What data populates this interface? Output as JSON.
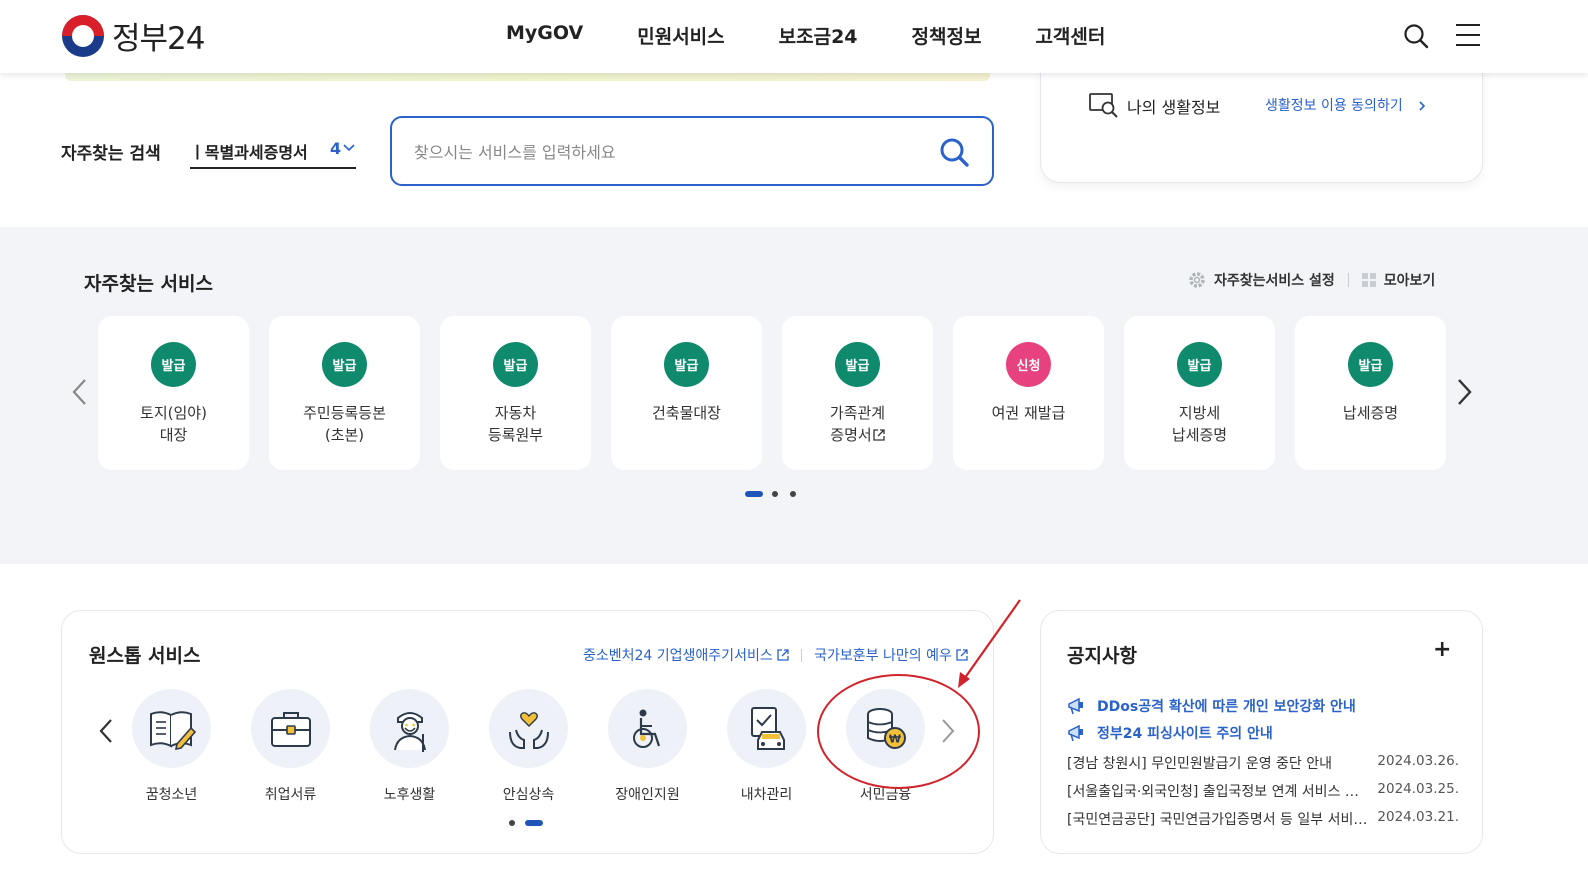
{
  "header": {
    "logo_text": "정부24",
    "nav": [
      "MyGOV",
      "민원서비스",
      "보조금24",
      "정책정보",
      "고객센터"
    ]
  },
  "search": {
    "freq_label": "자주찾는 검색",
    "freq_keyword": "ㅣ목별과세증명서",
    "freq_index": "4",
    "placeholder": "찾으시는 서비스를 입력하세요",
    "value": ""
  },
  "life_info": {
    "title": "나의 생활정보",
    "link": "생활정보 이용 동의하기"
  },
  "frequent_services": {
    "title": "자주찾는 서비스",
    "setting_label": "자주찾는서비스 설정",
    "view_all_label": "모아보기",
    "items": [
      {
        "badge": "발급",
        "name": "토지(임야)\n대장",
        "color": "#0f8a6d"
      },
      {
        "badge": "발급",
        "name": "주민등록등본\n(초본)",
        "color": "#0f8a6d"
      },
      {
        "badge": "발급",
        "name": "자동차\n등록원부",
        "color": "#0f8a6d"
      },
      {
        "badge": "발급",
        "name": "건축물대장",
        "color": "#0f8a6d"
      },
      {
        "badge": "발급",
        "name": "가족관계\n증명서",
        "color": "#0f8a6d",
        "external": true
      },
      {
        "badge": "신청",
        "name": "여권 재발급",
        "color": "#e8417f"
      },
      {
        "badge": "발급",
        "name": "지방세\n납세증명",
        "color": "#0f8a6d"
      },
      {
        "badge": "발급",
        "name": "납세증명",
        "color": "#0f8a6d"
      }
    ]
  },
  "onestop": {
    "title": "원스톱 서비스",
    "link1": "중소벤처24 기업생애주기서비스",
    "link2": "국가보훈부 나만의 예우",
    "items": [
      {
        "label": "꿈청소년",
        "icon": "book-pencil-icon"
      },
      {
        "label": "취업서류",
        "icon": "briefcase-icon"
      },
      {
        "label": "노후생활",
        "icon": "elder-icon"
      },
      {
        "label": "안심상속",
        "icon": "hands-heart-icon"
      },
      {
        "label": "장애인지원",
        "icon": "wheelchair-icon"
      },
      {
        "label": "내차관리",
        "icon": "car-document-icon"
      },
      {
        "label": "서민금융",
        "icon": "coins-icon"
      }
    ]
  },
  "notices": {
    "title": "공지사항",
    "plus": "+",
    "highlights": [
      "DDos공격 확산에 따른 개인 보안강화 안내",
      "정부24 피싱사이트 주의 안내"
    ],
    "rows": [
      {
        "title": "[경남 창원시] 무인민원발급기 운영 중단 안내",
        "date": "2024.03.26."
      },
      {
        "title": "[서울출입국·외국인청] 출입국정보 연계 서비스 순차 중단 안내",
        "date": "2024.03.25."
      },
      {
        "title": "[국민연금공단] 국민연금가입증명서 등 일부 서비스 중단 안내",
        "date": "2024.03.21."
      }
    ]
  },
  "colors": {
    "accent": "#2a62c9",
    "green_badge": "#0f8a6d",
    "pink_badge": "#e8417f",
    "annotation_red": "#d0232b"
  }
}
